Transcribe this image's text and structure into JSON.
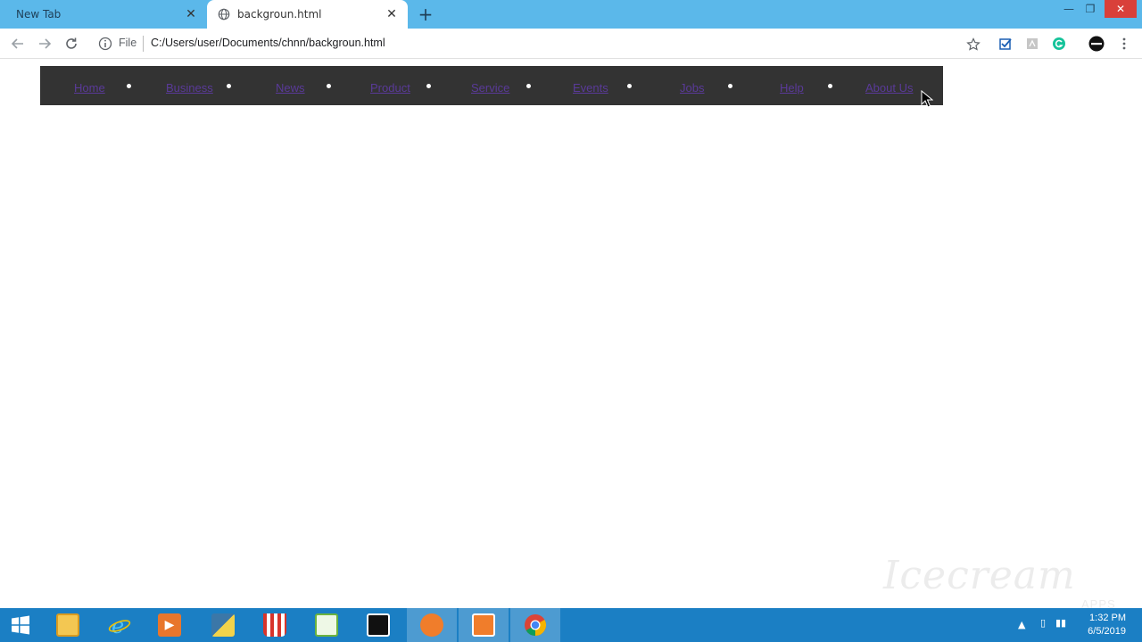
{
  "browser": {
    "tabs": [
      {
        "title": "New Tab",
        "active": false
      },
      {
        "title": "backgroun.html",
        "active": true
      }
    ],
    "address": {
      "scheme_label": "File",
      "url": "C:/Users/user/Documents/chnn/backgroun.html"
    }
  },
  "page": {
    "nav_links": [
      "Home",
      "Business",
      "News",
      "Product",
      "Service",
      "Events",
      "Jobs",
      "Help",
      "About Us"
    ],
    "nav_background": "#333333",
    "link_color": "#5a3a99"
  },
  "watermark": "Icecream",
  "watermark_sub": "APPS",
  "taskbar": {
    "time": "1:32 PM",
    "date": "6/5/2019"
  }
}
